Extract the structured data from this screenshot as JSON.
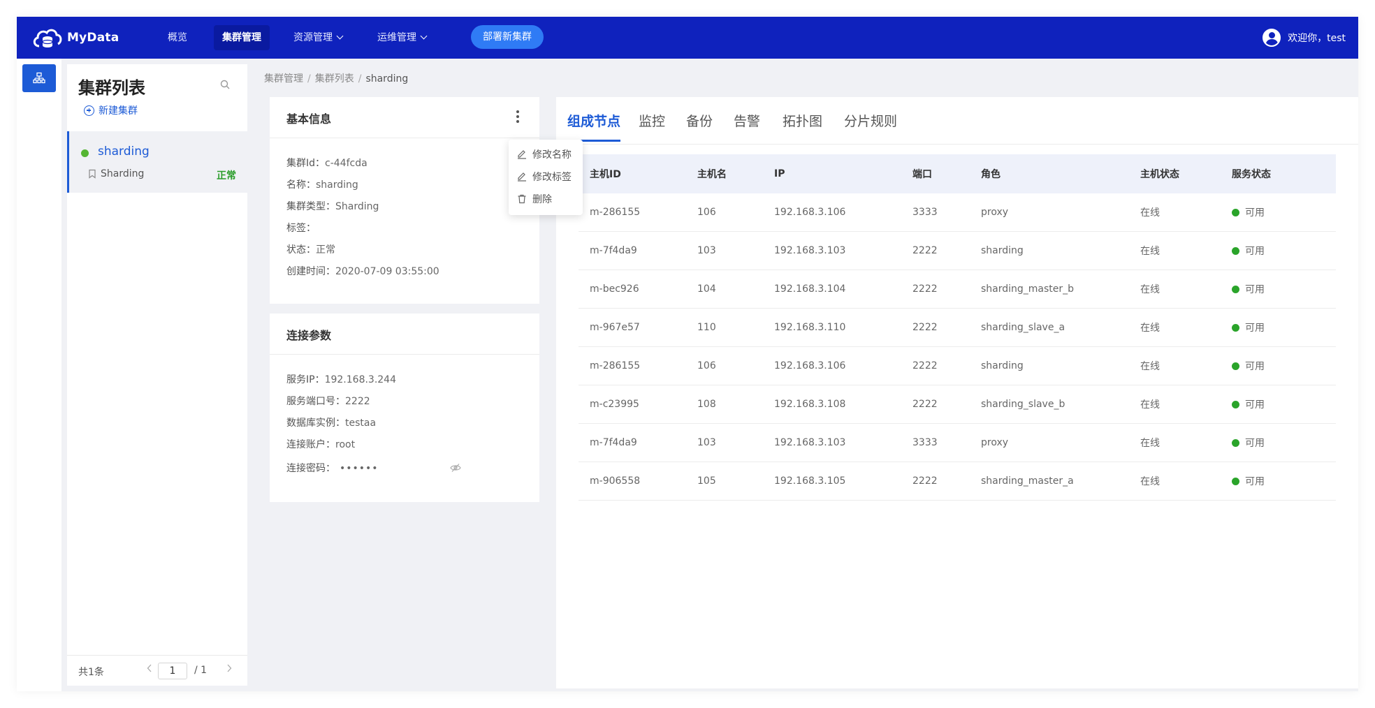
{
  "brand": {
    "name": "MyData"
  },
  "nav": {
    "overview": "概览",
    "cluster_mgmt": "集群管理",
    "resource_mgmt": "资源管理",
    "ops_mgmt": "运维管理",
    "deploy_button": "部署新集群"
  },
  "user": {
    "greeting": "欢迎你，test"
  },
  "cluster_list": {
    "title": "集群列表",
    "new_cluster": "新建集群",
    "items": [
      {
        "name": "sharding",
        "tag": "Sharding",
        "status": "正常"
      }
    ],
    "footer": {
      "total": "共1条",
      "page": "1",
      "pages": "/ 1"
    }
  },
  "breadcrumb": {
    "level1": "集群管理",
    "level2": "集群列表",
    "current": "sharding"
  },
  "basic_info": {
    "title": "基本信息",
    "cluster_id_label": "集群Id：",
    "cluster_id": "c-44fcda",
    "name_label": "名称：",
    "name": "sharding",
    "type_label": "集群类型：",
    "type": "Sharding",
    "tags_label": "标签：",
    "status_label": "状态：",
    "status": "正常",
    "created_label": "创建时间：",
    "created": "2020-07-09 03:55:00"
  },
  "menu": {
    "rename": "修改名称",
    "edit_tags": "修改标签",
    "delete": "删除"
  },
  "connection": {
    "title": "连接参数",
    "service_ip_label": "服务IP：",
    "service_ip": "192.168.3.244",
    "service_port_label": "服务端口号：",
    "service_port": "2222",
    "db_instance_label": "数据库实例：",
    "db_instance": "testaa",
    "account_label": "连接账户：",
    "account": "root",
    "password_label": "连接密码：",
    "password": "••••••"
  },
  "tabs": [
    "组成节点",
    "监控",
    "备份",
    "告警",
    "拓扑图",
    "分片规则"
  ],
  "table": {
    "headers": [
      "主机ID",
      "主机名",
      "IP",
      "端口",
      "角色",
      "主机状态",
      "服务状态"
    ],
    "rows": [
      [
        "m-286155",
        "106",
        "192.168.3.106",
        "3333",
        "proxy",
        "在线",
        "可用"
      ],
      [
        "m-7f4da9",
        "103",
        "192.168.3.103",
        "2222",
        "sharding",
        "在线",
        "可用"
      ],
      [
        "m-bec926",
        "104",
        "192.168.3.104",
        "2222",
        "sharding_master_b",
        "在线",
        "可用"
      ],
      [
        "m-967e57",
        "110",
        "192.168.3.110",
        "2222",
        "sharding_slave_a",
        "在线",
        "可用"
      ],
      [
        "m-286155",
        "106",
        "192.168.3.106",
        "2222",
        "sharding",
        "在线",
        "可用"
      ],
      [
        "m-c23995",
        "108",
        "192.168.3.108",
        "2222",
        "sharding_slave_b",
        "在线",
        "可用"
      ],
      [
        "m-7f4da9",
        "103",
        "192.168.3.103",
        "3333",
        "proxy",
        "在线",
        "可用"
      ],
      [
        "m-906558",
        "105",
        "192.168.3.105",
        "2222",
        "sharding_master_a",
        "在线",
        "可用"
      ]
    ]
  },
  "colors": {
    "topbar": "#0f22bd",
    "accent": "#1d5bd6",
    "deploy": "#2f7bf5",
    "ok": "#2aa42a"
  },
  "icons": [
    "logo-cloud-icon",
    "chevron-down-icon",
    "user-avatar-icon",
    "cluster-nav-icon",
    "search-icon",
    "plus-circle-icon",
    "bookmark-icon",
    "more-vertical-icon",
    "edit-icon",
    "trash-icon",
    "eye-off-icon",
    "chevron-left-icon",
    "chevron-right-icon"
  ]
}
